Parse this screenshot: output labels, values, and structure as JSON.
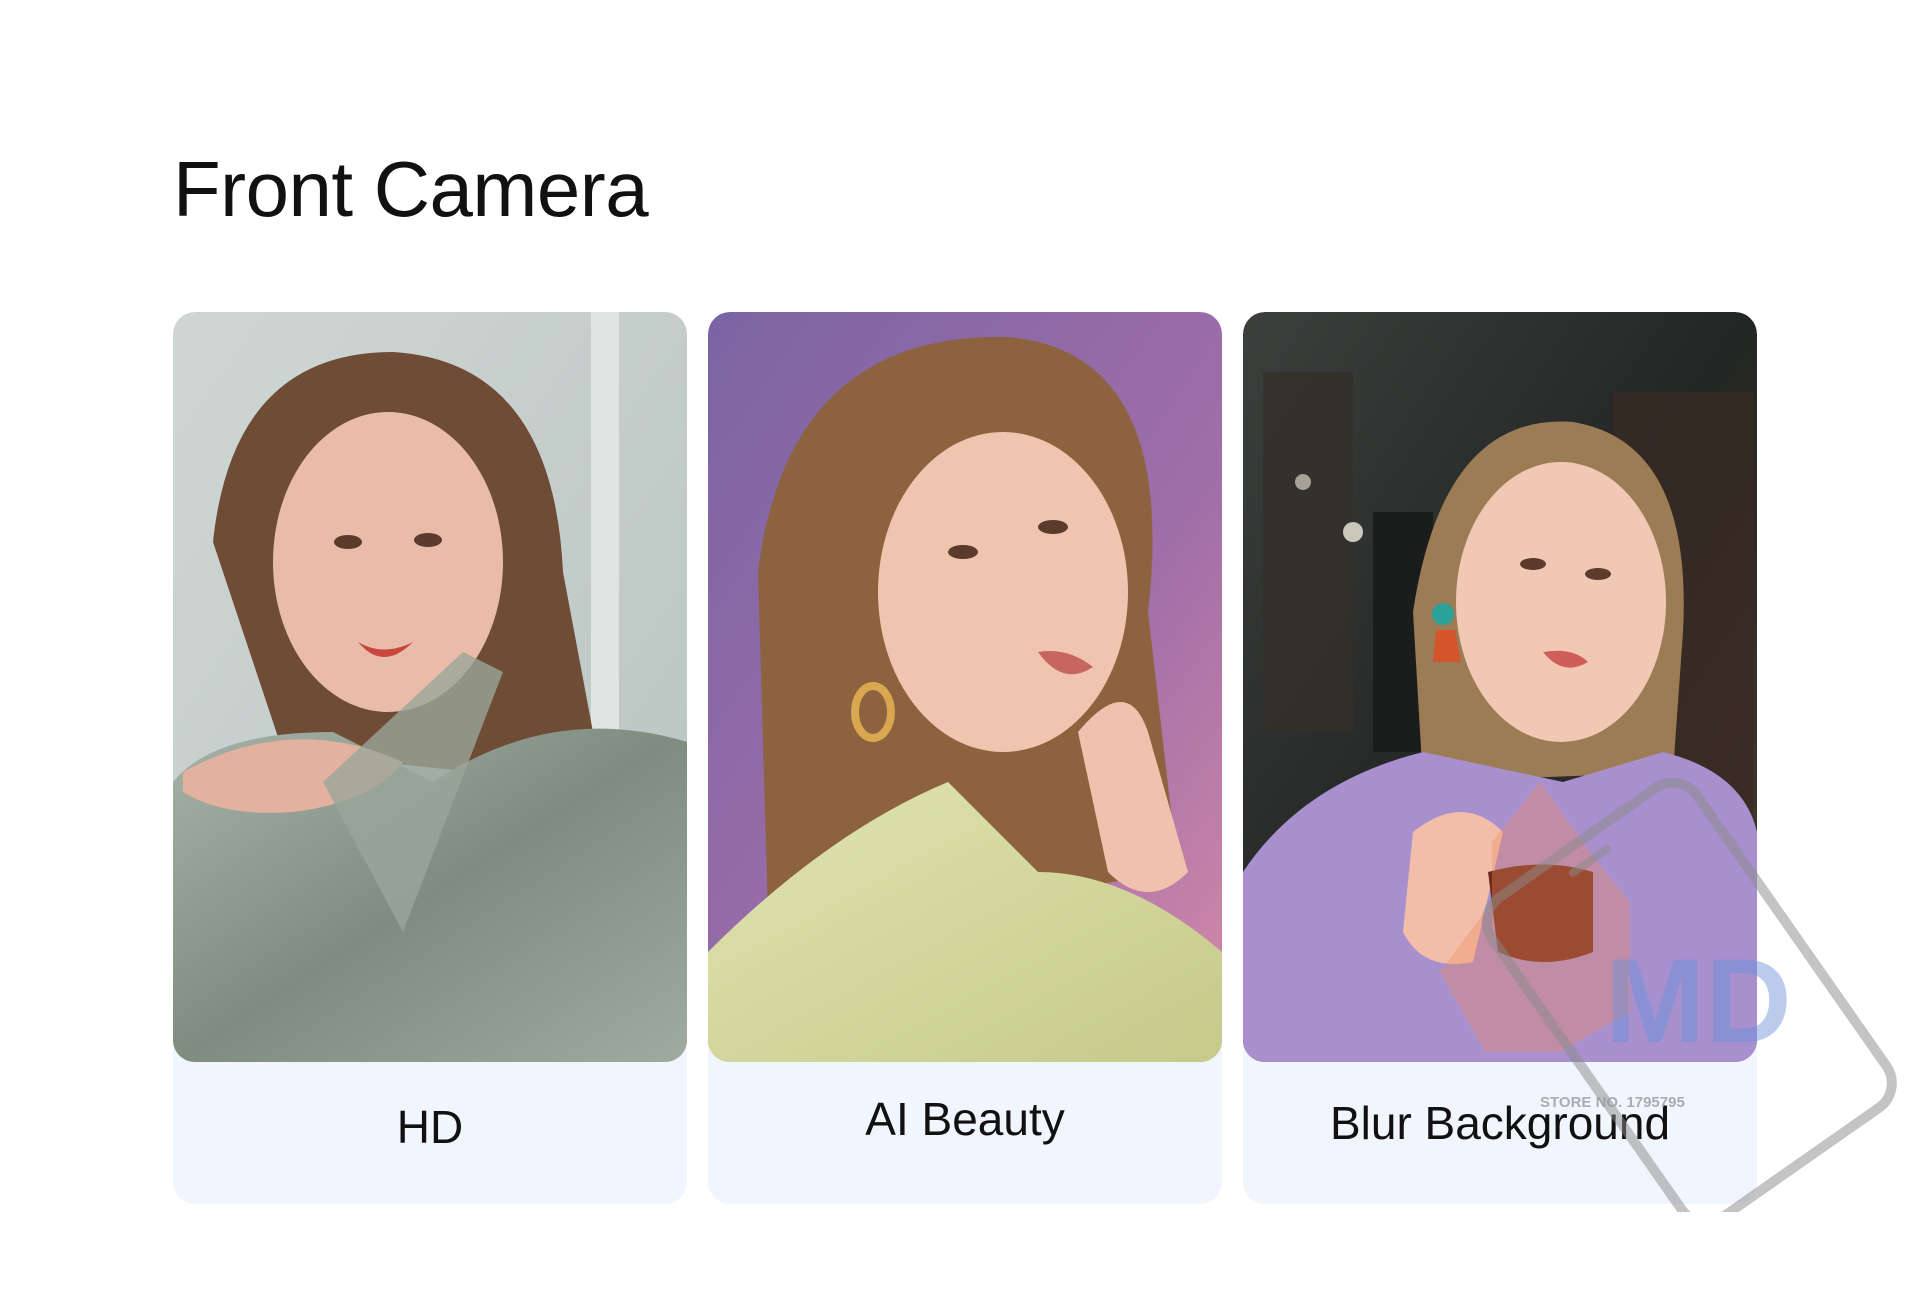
{
  "page": {
    "title": "Front Camera"
  },
  "cards": [
    {
      "label": "HD",
      "photo": "portrait-silver-satin",
      "palette": {
        "bg": "#c9d3d0",
        "accent": "#9aa8a0",
        "hair": "#6b4a34",
        "skin": "#e7b8a6",
        "clothes": "#8e9a8c"
      }
    },
    {
      "label": "AI Beauty",
      "photo": "portrait-violet-backdrop",
      "palette": {
        "bg": "#8a6aa6",
        "accent": "#c47ea8",
        "hair": "#8a5f3e",
        "skin": "#efc4ae",
        "clothes": "#d8dca0"
      }
    },
    {
      "label": "Blur Background",
      "photo": "portrait-cafe-lilac",
      "palette": {
        "bg": "#2b2e2c",
        "accent": "#5a5040",
        "hair": "#9a7a52",
        "skin": "#f0c6b0",
        "clothes": "#a78fcd"
      }
    }
  ],
  "watermark": {
    "text": "STORE NO. 1795795",
    "letters": "MD",
    "icon": "phone-gear-watermark-icon",
    "colors": {
      "gear": "#f08a5a",
      "letters": "#6a8ed8",
      "outline": "#888888"
    }
  }
}
